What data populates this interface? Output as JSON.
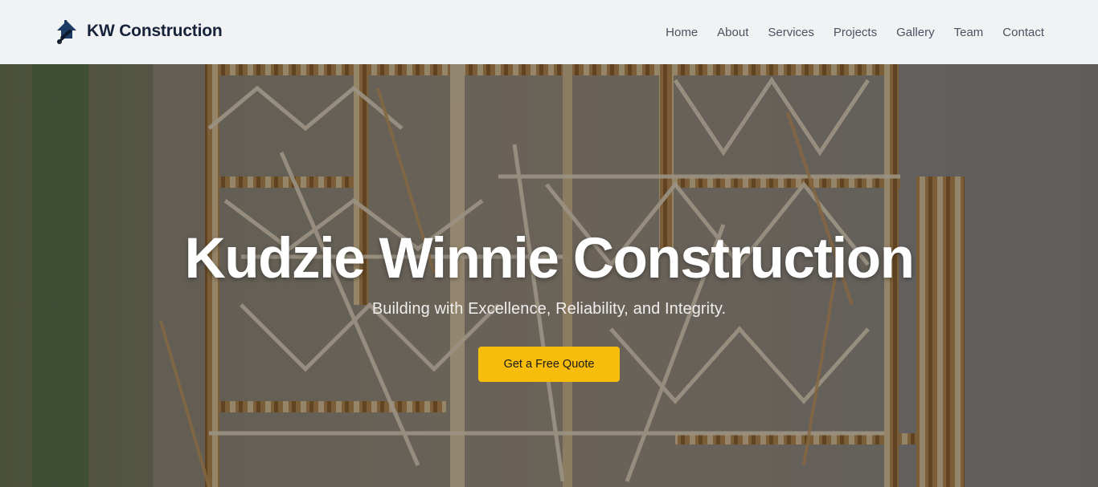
{
  "header": {
    "brand_name": "KW Construction",
    "brand_icon": "roof-hammer-icon",
    "nav": [
      {
        "label": "Home"
      },
      {
        "label": "About"
      },
      {
        "label": "Services"
      },
      {
        "label": "Projects"
      },
      {
        "label": "Gallery"
      },
      {
        "label": "Team"
      },
      {
        "label": "Contact"
      }
    ]
  },
  "hero": {
    "title": "Kudzie Winnie Construction",
    "subtitle": "Building with Excellence, Reliability, and Integrity.",
    "cta_label": "Get a Free Quote"
  },
  "colors": {
    "header_bg": "#f1f2f4",
    "brand_text": "#16213a",
    "nav_text": "#4b5260",
    "cta_bg": "#f7bd0a",
    "hero_text": "#ffffff"
  }
}
